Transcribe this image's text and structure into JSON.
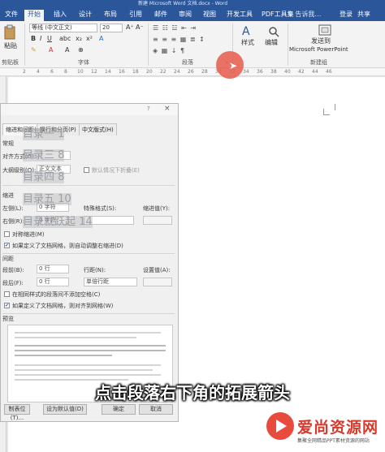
{
  "window": {
    "title": "新建 Microsoft Word 文档.docx - Word"
  },
  "ribbon_tabs": [
    {
      "label": "文件"
    },
    {
      "label": "开始",
      "active": true
    },
    {
      "label": "插入"
    },
    {
      "label": "设计"
    },
    {
      "label": "布局"
    },
    {
      "label": "引用"
    },
    {
      "label": "邮件"
    },
    {
      "label": "审阅"
    },
    {
      "label": "视图"
    },
    {
      "label": "开发工具"
    },
    {
      "label": "PDF工具集"
    }
  ],
  "tell_me": "♀ 告诉我…",
  "account": {
    "signin": "登录",
    "share": "共享"
  },
  "ribbon": {
    "paste_label": "粘贴",
    "clipboard_label": "剪贴板",
    "font_name": "等线 (中文正文)",
    "font_size": "20",
    "font_group_label": "字体",
    "paragraph_group_label": "段落",
    "styles_label": "样式",
    "editing_label": "编辑",
    "send_to_line1": "发送到",
    "send_to_line2": "Microsoft PowerPoint",
    "new_group_label": "新建组"
  },
  "ruler_ticks": [
    "2",
    "4",
    "6",
    "8",
    "10",
    "12",
    "14",
    "16",
    "18",
    "20",
    "22",
    "24",
    "26",
    "28",
    "30",
    "32",
    "34",
    "36",
    "38",
    "40",
    "42",
    "44",
    "46"
  ],
  "dialog": {
    "help": "?",
    "tabs": [
      "缩进和间距(I)",
      "换行和分页(P)",
      "中文版式(H)"
    ],
    "section_general": "常规",
    "alignment_label": "对齐方式(G):",
    "outline_label": "大纲级别(O):",
    "outline_value": "正文文本",
    "collapsed_label": "默认情况下折叠(E)",
    "section_indent": "缩进",
    "left_label": "左侧(L):",
    "left_value": "0 字符",
    "right_label": "右侧(R):",
    "right_value": "0 字符",
    "special_label": "特殊格式(S):",
    "indent_by_label": "缩进值(Y):",
    "mirror_label": "对称缩进(M)",
    "auto_adjust_label": "如果定义了文档网格，则自动调整右缩进(D)",
    "section_spacing": "间距",
    "before_label": "段前(B):",
    "before_value": "0 行",
    "after_label": "段后(F):",
    "after_value": "0 行",
    "line_spacing_label": "行距(N):",
    "line_spacing_value": "单倍行距",
    "at_label": "设置值(A):",
    "no_space_label": "在相同样式的段落间不添加空格(C)",
    "snap_grid_label": "如果定义了文档网格，则对齐到网格(W)",
    "section_preview": "预览",
    "tabs_button": "制表位(T)...",
    "default_button": "设为默认值(D)",
    "ok_button": "确定",
    "cancel_button": "取消"
  },
  "toc_lines": [
    "目录一 1",
    "目录三 8",
    "目录四 8",
    "目录五 10",
    "目录就跃起 14"
  ],
  "subtitle": "点击段落右下角的拓展箭头",
  "watermark": {
    "name": "爱尚资源网",
    "tagline": "集聚全网精品PPT素材资源的网站"
  }
}
